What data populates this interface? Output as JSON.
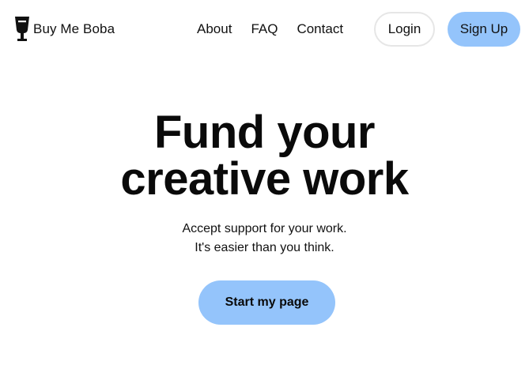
{
  "header": {
    "brand": {
      "name": "Buy Me Boba",
      "icon": "boba-cup-icon"
    },
    "nav": [
      {
        "label": "About"
      },
      {
        "label": "FAQ"
      },
      {
        "label": "Contact"
      }
    ],
    "login_label": "Login",
    "signup_label": "Sign Up"
  },
  "hero": {
    "title_line1": "Fund your",
    "title_line2": "creative work",
    "subtitle_line1": "Accept support for your work.",
    "subtitle_line2": "It's easier than you think.",
    "cta_label": "Start my page"
  },
  "colors": {
    "accent": "#94c4fb",
    "text": "#111111",
    "background": "#ffffff",
    "login_border": "#e6e6e6"
  }
}
